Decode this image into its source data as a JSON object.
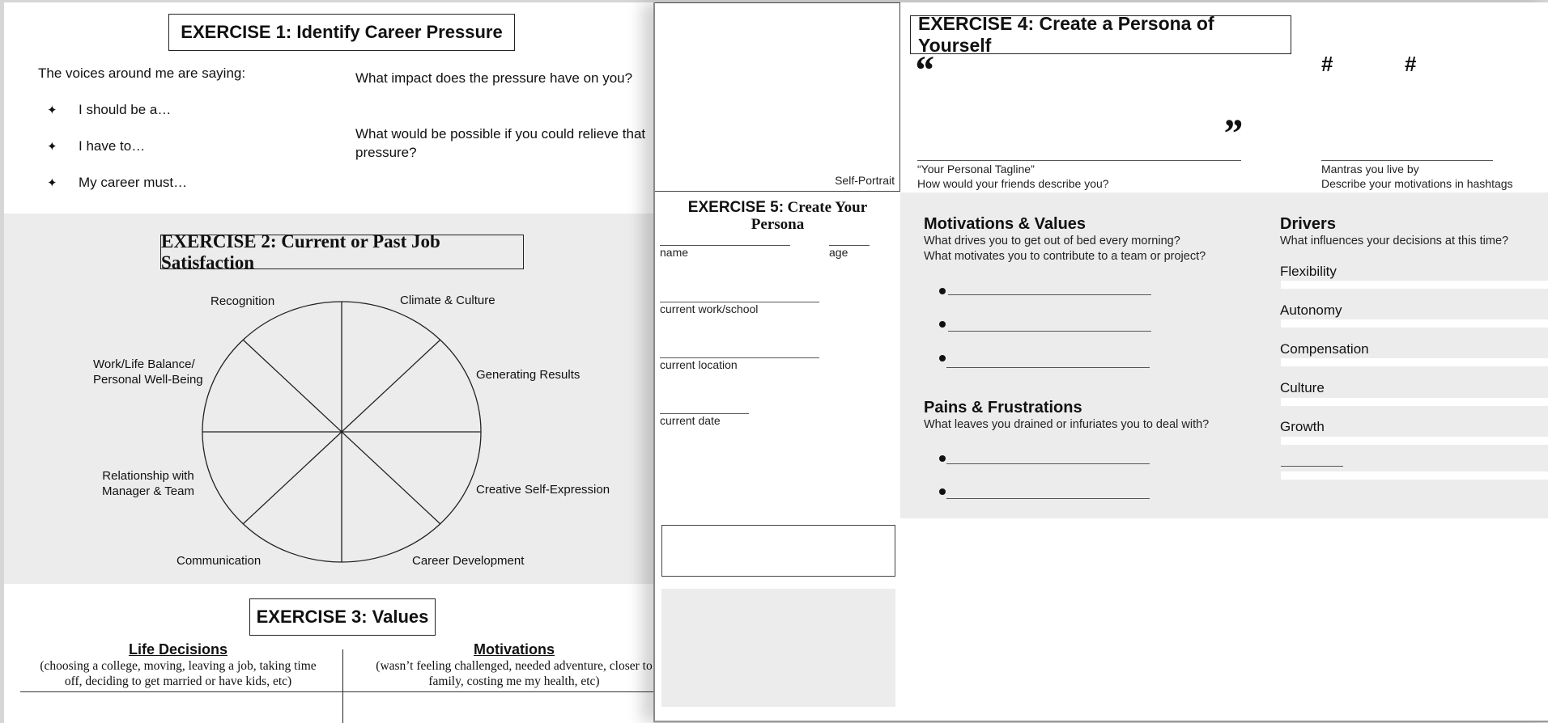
{
  "exercise1": {
    "title": "EXERCISE 1: Identify Career Pressure",
    "voices_label": "The voices around me are saying:",
    "bullets": [
      "I should be a…",
      "I have to…",
      "My career must…"
    ],
    "bullet_icon": "✦",
    "question1": "What impact does the pressure have on you?",
    "question2": "What would be possible if you could relieve that pressure?"
  },
  "exercise2": {
    "title": "EXERCISE 2: Current or Past Job Satisfaction",
    "wheel_segments": [
      "Recognition",
      "Climate & Culture",
      "Generating Results",
      "Creative Self-Expression",
      "Career Development",
      "Communication",
      "Relationship with Manager & Team",
      "Work/Life Balance/ Personal Well-Being"
    ],
    "labels": {
      "recognition": "Recognition",
      "climate": "Climate & Culture",
      "results": "Generating Results",
      "creative": "Creative Self-Expression",
      "career": "Career Development",
      "communication": "Communication",
      "relationship_1": "Relationship with",
      "relationship_2": "Manager & Team",
      "worklife_1": "Work/Life Balance/",
      "worklife_2": "Personal Well-Being"
    }
  },
  "exercise3": {
    "title": "EXERCISE 3: Values",
    "columns": [
      {
        "heading": "Life Decisions",
        "line1": "(choosing a college, moving, leaving a job, taking time",
        "line2": "off, deciding to get married or have kids, etc)"
      },
      {
        "heading": "Motivations",
        "line1": "(wasn’t feeling challenged, needed adventure, closer to",
        "line2": "family, costing me my health, etc)"
      }
    ]
  },
  "exercise4": {
    "title": "EXERCISE 4: Create a Persona of Yourself",
    "open_quote": "“",
    "close_quote": "”",
    "tagline_label": "“Your Personal Tagline”",
    "tagline_sub": "How would your friends describe you?",
    "hashtag": "#",
    "mantras_label": "Mantras you live by",
    "mantras_sub": "Describe your motivations in hashtags",
    "self_portrait_label": "Self-Portrait",
    "motivations": {
      "title": "Motivations & Values",
      "q1": "What drives you to get out of bed every morning?",
      "q2": "What motivates you to contribute to a team or project?"
    },
    "pains": {
      "title": "Pains & Frustrations",
      "q1": "What leaves you drained or infuriates you to deal with?"
    },
    "drivers": {
      "title": "Drivers",
      "subtitle": "What influences your decisions at this time?",
      "items": [
        "Flexibility",
        "Autonomy",
        "Compensation",
        "Culture",
        "Growth"
      ]
    }
  },
  "exercise5": {
    "title_bold": "EXERCISE 5:",
    "title_rest_1": "Create Your",
    "title_rest_2": "Persona",
    "fields": {
      "name": "name",
      "age": "age",
      "work": "current work/school",
      "location": "current location",
      "date": "current date"
    }
  }
}
